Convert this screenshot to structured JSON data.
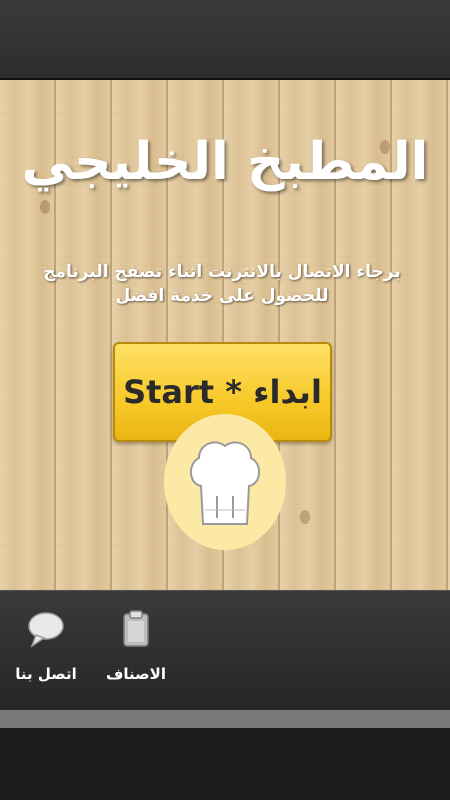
{
  "app": {
    "title": "المطبخ الخليجي",
    "notice": "برجاء الاتصال بالانترنت اثناء تصفح البرنامج للحصول على خدمة افضل",
    "start_label": "Start * ابداء"
  },
  "chef_icon": "chef-hat-icon",
  "nav": {
    "items": [
      {
        "label": "اتصل بنا",
        "icon": "speech-bubble-icon"
      },
      {
        "label": "الاصناف",
        "icon": "clipboard-icon"
      }
    ]
  },
  "colors": {
    "button_yellow": "#f7c928",
    "circle_cream": "#fde9a6",
    "wood": "#e2c89c",
    "bar_dark": "#2e2e2e"
  }
}
